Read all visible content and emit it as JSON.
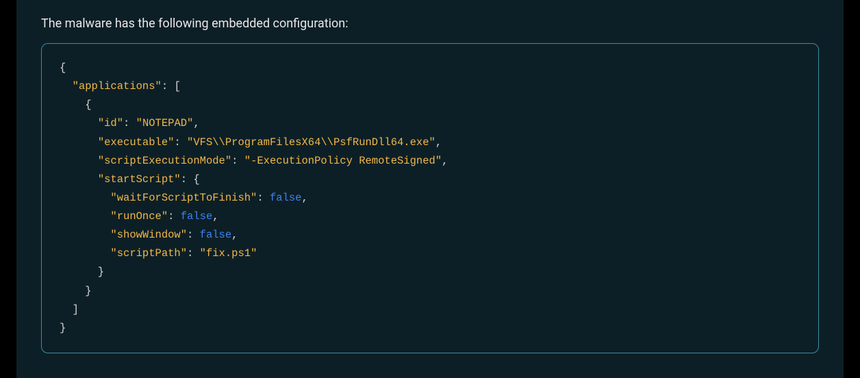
{
  "intro": "The malware has the following embedded configuration:",
  "code": {
    "l1": "{",
    "l2a": "  ",
    "l2b": "\"applications\"",
    "l2c": ": [",
    "l3": "    {",
    "l4a": "      ",
    "l4b": "\"id\"",
    "l4c": ": ",
    "l4d": "\"NOTEPAD\"",
    "l4e": ",",
    "l5a": "      ",
    "l5b": "\"executable\"",
    "l5c": ": ",
    "l5d": "\"VFS\\\\ProgramFilesX64\\\\PsfRunDll64.exe\"",
    "l5e": ",",
    "l6a": "      ",
    "l6b": "\"scriptExecutionMode\"",
    "l6c": ": ",
    "l6d": "\"-ExecutionPolicy RemoteSigned\"",
    "l6e": ",",
    "l7a": "      ",
    "l7b": "\"startScript\"",
    "l7c": ": {",
    "l8a": "        ",
    "l8b": "\"waitForScriptToFinish\"",
    "l8c": ": ",
    "l8d": "false",
    "l8e": ",",
    "l9a": "        ",
    "l9b": "\"runOnce\"",
    "l9c": ": ",
    "l9d": "false",
    "l9e": ",",
    "l10a": "        ",
    "l10b": "\"showWindow\"",
    "l10c": ": ",
    "l10d": "false",
    "l10e": ",",
    "l11a": "        ",
    "l11b": "\"scriptPath\"",
    "l11c": ": ",
    "l11d": "\"fix.ps1\"",
    "l12": "      }",
    "l13": "    }",
    "l14": "  ]",
    "l15": "}"
  }
}
